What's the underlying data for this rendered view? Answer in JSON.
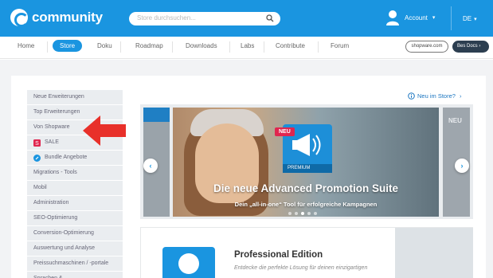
{
  "header": {
    "brand": "community",
    "search_placeholder": "Store durchsuchen...",
    "account_label": "Account",
    "language": "DE"
  },
  "nav": {
    "items": [
      "Home",
      "Store",
      "Doku",
      "Roadmap",
      "Downloads",
      "Labs",
      "Contribute",
      "Forum"
    ],
    "active": "Store",
    "link_button": "shopware.com",
    "dark_button": "Bes Docs"
  },
  "sidebar": {
    "items": [
      {
        "label": "Neue Erweiterungen",
        "icon": ""
      },
      {
        "label": "Top Erweiterungen",
        "icon": ""
      },
      {
        "label": "Von Shopware",
        "icon": ""
      },
      {
        "label": "SALE",
        "icon": "sale-tag-icon"
      },
      {
        "label": "Bundle Angebote",
        "icon": "bundle-icon"
      },
      {
        "label": "Migrations - Tools",
        "icon": ""
      },
      {
        "label": "Mobil",
        "icon": ""
      },
      {
        "label": "Administration",
        "icon": ""
      },
      {
        "label": "SEO-Optimierung",
        "icon": ""
      },
      {
        "label": "Conversion-Optimierung",
        "icon": ""
      },
      {
        "label": "Auswertung und Analyse",
        "icon": ""
      },
      {
        "label": "Preissuchmaschinen / -portale",
        "icon": ""
      },
      {
        "label": "Sprachen &",
        "icon": ""
      }
    ]
  },
  "store": {
    "new_in_store": "Neu im Store?"
  },
  "slider": {
    "badge_new": "NEU",
    "badge_premium": "PREMIUM",
    "headline": "Die neue Advanced Promotion Suite",
    "subline": "Dein „all-in-one“ Tool für erfolgreiche Kampagnen",
    "right_peek_label": "NEU",
    "dots": 5,
    "active_dot": 2
  },
  "product": {
    "title": "Professional Edition",
    "description": "Entdecke die perfekte Lösung für deinen einzigartigen"
  },
  "colors": {
    "brand_blue": "#1a95e0",
    "sale_red": "#e0264f",
    "annotation_arrow": "#e8302a"
  }
}
